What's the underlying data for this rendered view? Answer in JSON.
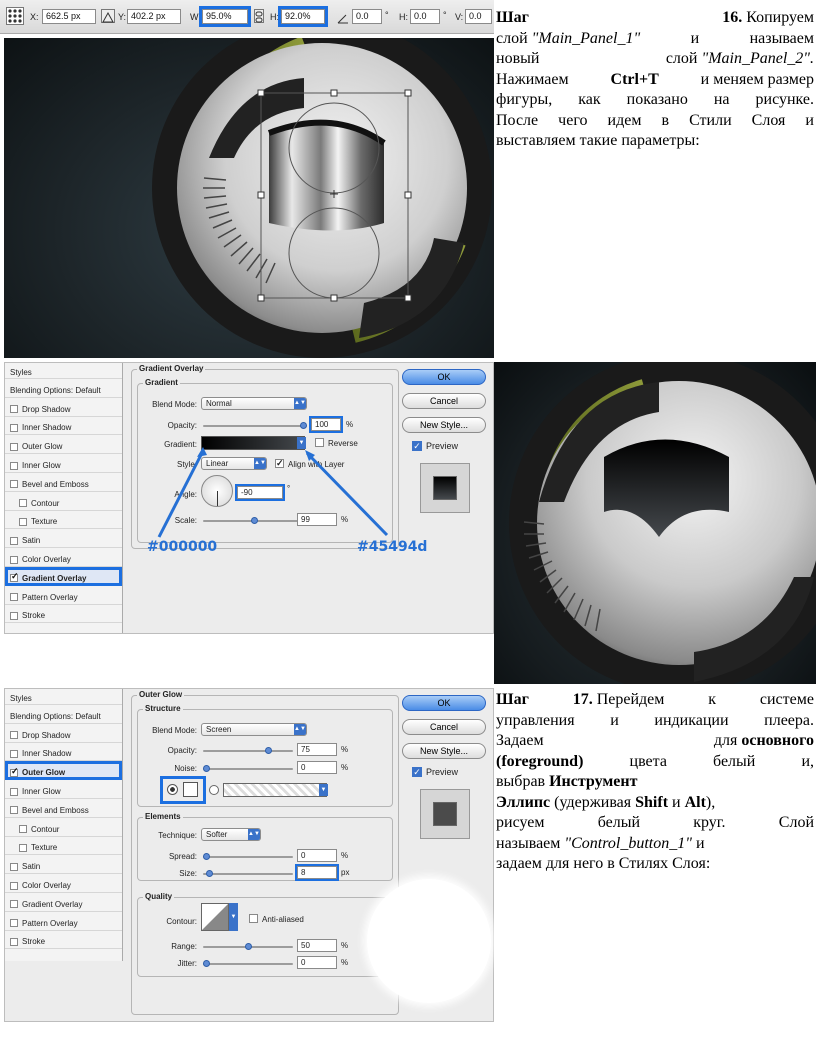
{
  "toolbar": {
    "x_label": "X:",
    "x_value": "662.5 px",
    "y_label": "Y:",
    "y_value": "402.2 px",
    "w_label": "W:",
    "w_value": "95.0%",
    "h_label": "H:",
    "h_value": "92.0%",
    "angle_value": "0.0",
    "degree": "°",
    "hskew_label": "H:",
    "hskew_value": "0.0",
    "vskew_label": "V:",
    "vskew_value": "0.0"
  },
  "step16": {
    "step": "Шаг",
    "num": "16.",
    "l1_rest": "Копируем",
    "l2_a": "слой",
    "l2_b": "\"Main_Panel_1\"",
    "l2_c": "и",
    "l2_d": "называем",
    "l3_a": "новый",
    "l3_b": "слой",
    "l3_c": "\"Main_Panel_2\".",
    "l4_a": "Нажимаем",
    "l4_b": "Ctrl+T",
    "l4_c": "и меняем размер",
    "l5": "фигуры, как показано на рисунке.",
    "l6": "После чего идем в Стили Слоя и",
    "l7": "выставляем такие параметры:"
  },
  "gradient_dialog": {
    "styles_header": "Styles",
    "items": [
      "Blending Options: Default",
      "Drop Shadow",
      "Inner Shadow",
      "Outer Glow",
      "Inner Glow",
      "Bevel and Emboss",
      "Contour",
      "Texture",
      "Satin",
      "Color Overlay",
      "Gradient Overlay",
      "Pattern Overlay",
      "Stroke"
    ],
    "section": "Gradient Overlay",
    "group": "Gradient",
    "blend_label": "Blend Mode:",
    "blend_value": "Normal",
    "opacity_label": "Opacity:",
    "opacity_value": "100",
    "opacity": 1.0,
    "gradient_label": "Gradient:",
    "reverse_label": "Reverse",
    "style_label": "Style:",
    "style_value": "Linear",
    "align_label": "Align with Layer",
    "angle_label": "Angle:",
    "angle_value": "-90",
    "degree": "°",
    "scale_label": "Scale:",
    "scale_value": "99",
    "scale": 0.99,
    "percent": "%",
    "ok": "OK",
    "cancel": "Cancel",
    "new_style": "New Style...",
    "preview": "Preview",
    "color_start": "#000000",
    "color_end": "#45494d"
  },
  "glow_dialog": {
    "styles_header": "Styles",
    "items": [
      "Blending Options: Default",
      "Drop Shadow",
      "Inner Shadow",
      "Outer Glow",
      "Inner Glow",
      "Bevel and Emboss",
      "Contour",
      "Texture",
      "Satin",
      "Color Overlay",
      "Gradient Overlay",
      "Pattern Overlay",
      "Stroke"
    ],
    "section": "Outer Glow",
    "structure": "Structure",
    "blend_label": "Blend Mode:",
    "blend_value": "Screen",
    "opacity_label": "Opacity:",
    "opacity_value": "75",
    "opacity": 0.75,
    "noise_label": "Noise:",
    "noise_value": "0",
    "noise": 0,
    "elements": "Elements",
    "technique_label": "Technique:",
    "technique_value": "Softer",
    "spread_label": "Spread:",
    "spread_value": "0",
    "spread": 0,
    "size_label": "Size:",
    "size_value": "8",
    "size": 0.04,
    "quality": "Quality",
    "contour_label": "Contour:",
    "antialiased_label": "Anti-aliased",
    "range_label": "Range:",
    "range_value": "50",
    "range": 0.5,
    "jitter_label": "Jitter:",
    "jitter_value": "0",
    "jitter": 0,
    "percent": "%",
    "px": "px",
    "ok": "OK",
    "cancel": "Cancel",
    "new_style": "New Style...",
    "preview": "Preview"
  },
  "step17": {
    "step": "Шаг",
    "num": "17.",
    "l1_a": "Перейдем",
    "l1_b": "к",
    "l1_c": "системе",
    "l2": "управления и индикации плеера.",
    "l3_a": "Задаем",
    "l3_b": "для",
    "l3_c": "основного",
    "l4_a": "(foreground)",
    "l4_b": "цвета",
    "l4_c": "белый",
    "l4_d": "и,",
    "l5_a": "выбрав",
    "l5_b": "Инструмент",
    "l6_a": "Эллипс",
    "l6_b": "(удерживая",
    "l6_c": "Shift",
    "l6_d": "и",
    "l6_e": "Alt",
    "l6_f": "),",
    "l7_a": "рисуем",
    "l7_b": "белый",
    "l7_c": "круг.",
    "l7_d": "Слой",
    "l8_a": "называем",
    "l8_b": "\"Control_button_1\"",
    "l8_c": "и",
    "l9": "задаем для него в Стилях Слоя:"
  }
}
